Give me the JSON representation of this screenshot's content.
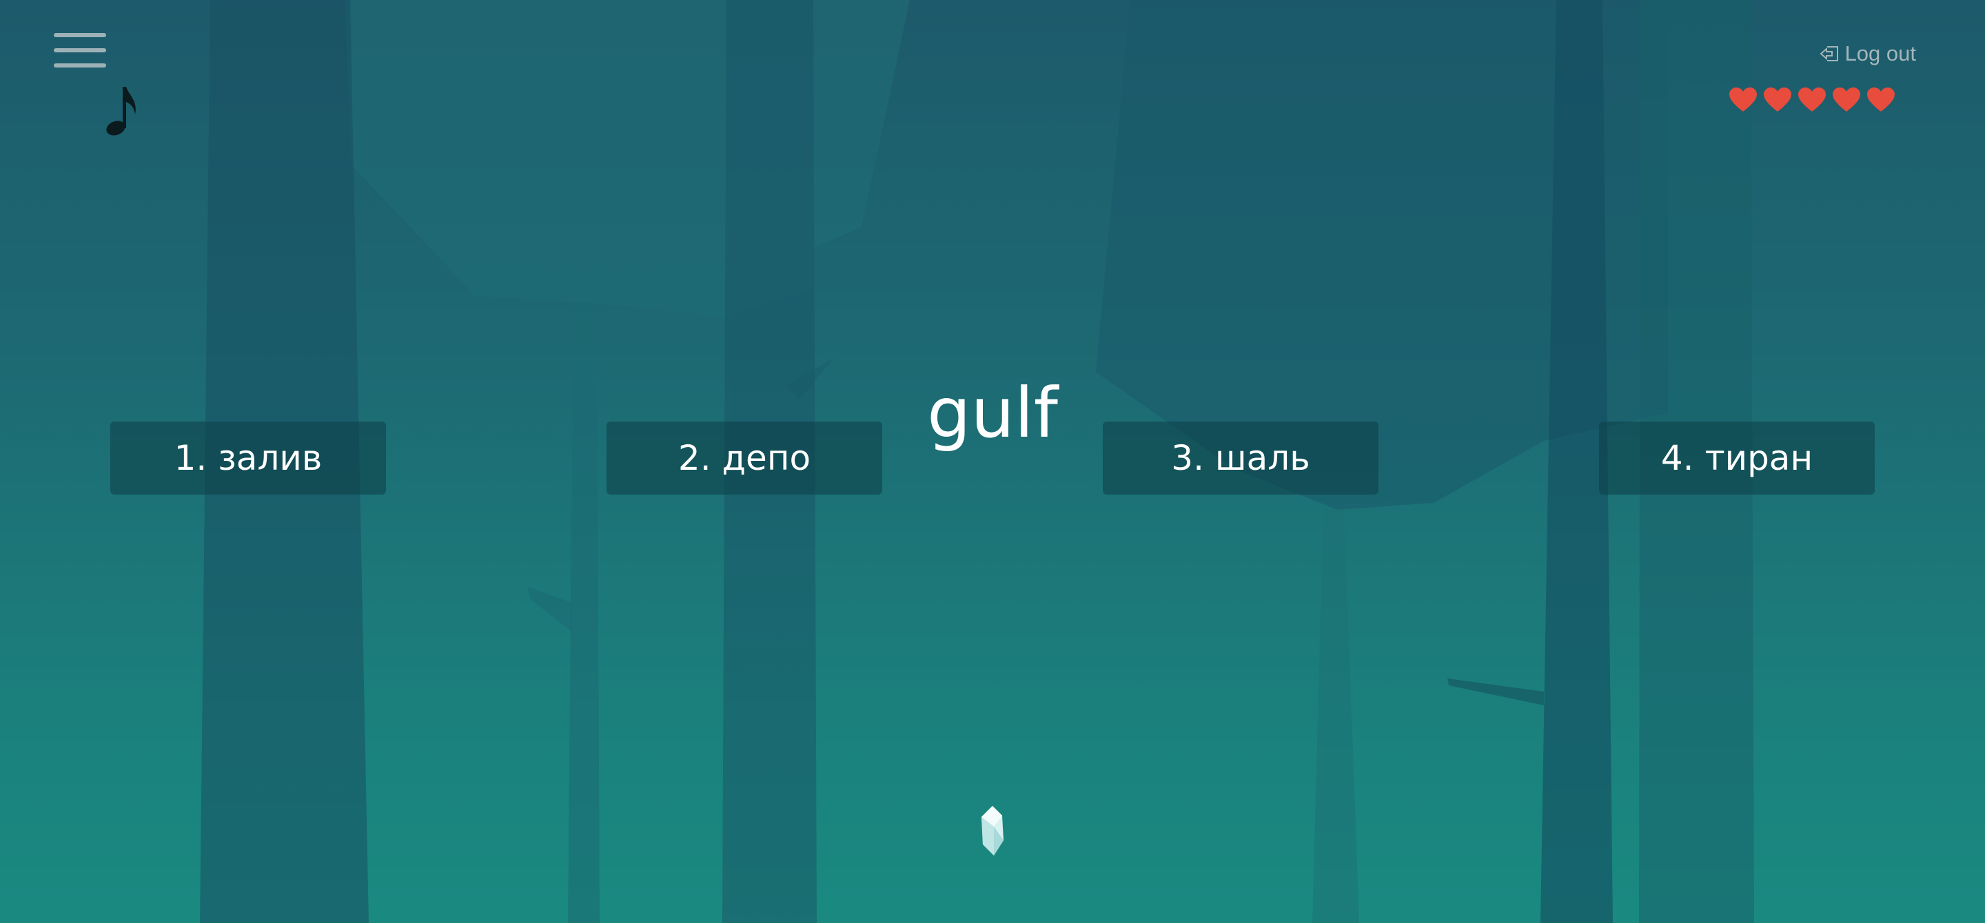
{
  "header": {
    "menu_icon": "hamburger-menu-icon",
    "music_icon": "music-note-icon",
    "logout_icon": "logout-arrow-icon",
    "logout_label": "Log out"
  },
  "lives": {
    "count": 5,
    "max": 5,
    "icon": "heart-icon",
    "color": "#e74c3c"
  },
  "question": {
    "word": "gulf"
  },
  "answers": [
    {
      "label": "1. залив"
    },
    {
      "label": "2. депо"
    },
    {
      "label": "3. шаль"
    },
    {
      "label": "4. тиран"
    }
  ],
  "player": {
    "icon": "crystal-icon"
  },
  "colors": {
    "background_top": "#1d5a6b",
    "background_bottom": "#1a8a80",
    "button_bg": "#164f58",
    "text": "#ffffff",
    "muted_text": "#a3b6ba"
  }
}
